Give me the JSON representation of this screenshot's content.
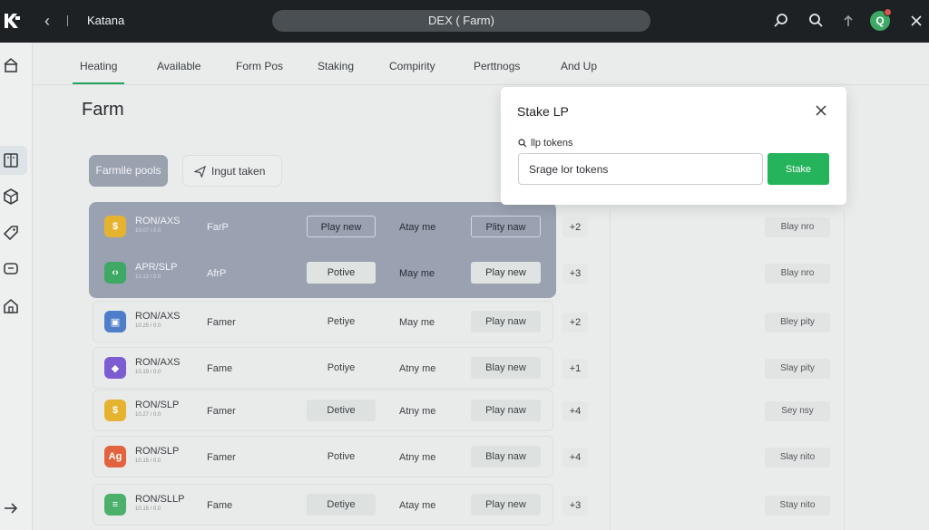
{
  "topbar": {
    "app_name": "Katana",
    "url_title": "DEX ( Farm)",
    "avatar_initial": "Q",
    "badge_color": "#d9534f"
  },
  "tabs": [
    {
      "label": "Heating",
      "active": true
    },
    {
      "label": "Available"
    },
    {
      "label": "Form Pos"
    },
    {
      "label": "Staking"
    },
    {
      "label": "Compirity"
    },
    {
      "label": "Perttnogs"
    },
    {
      "label": "And Up"
    }
  ],
  "page_title": "Farm",
  "filters": {
    "active_label": "Farmile pools",
    "input_label": "Ingut taken"
  },
  "rows": [
    {
      "pair": "RON/AXS",
      "sub": "10.07 / 0.0",
      "type": "FarP",
      "status": "Play new",
      "time": "Atay me",
      "action": "Plity naw",
      "count": "+2",
      "right": "Blay nro",
      "icon": "coin-icon",
      "icon_color": "#e6b331",
      "highlighted": true
    },
    {
      "pair": "APR/SLP",
      "sub": "10.12 / 0.0",
      "type": "AfrP",
      "status": "Potive",
      "time": "May me",
      "action": "Play new",
      "count": "+3",
      "right": "Blay nro",
      "icon": "code-icon",
      "icon_color": "#3ea865",
      "highlighted": true
    },
    {
      "pair": "RON/AXS",
      "sub": "10.25 / 0.0",
      "type": "Famer",
      "status": "Petiye",
      "time": "May me",
      "action": "Play naw",
      "count": "+2",
      "right": "Bley pity",
      "icon": "cube-icon",
      "icon_color": "#4e7ec9"
    },
    {
      "pair": "RON/AXS",
      "sub": "10.19 / 0.0",
      "type": "Fame",
      "status": "Potiye",
      "time": "Atny me",
      "action": "Blay new",
      "count": "+1",
      "right": "Slay pity",
      "icon": "shield-icon",
      "icon_color": "#7d5bd1"
    },
    {
      "pair": "RON/SLP",
      "sub": "10.27 / 0.0",
      "type": "Famer",
      "status": "Detive",
      "time": "Atny me",
      "action": "Play naw",
      "count": "+4",
      "right": "Sey nsy",
      "icon": "coin-icon",
      "icon_color": "#e6b331"
    },
    {
      "pair": "RON/SLP",
      "sub": "10.15 / 0.0",
      "type": "Famer",
      "status": "Potive",
      "time": "Atny me",
      "action": "Blay naw",
      "count": "+4",
      "right": "Slay nito",
      "icon": "ag-icon",
      "icon_color": "#e2643f"
    },
    {
      "pair": "RON/SLLP",
      "sub": "10.15 / 0.0",
      "type": "Fame",
      "status": "Detiye",
      "time": "Atay me",
      "action": "Play new",
      "count": "+3",
      "right": "Stay nito",
      "icon": "wifi-icon",
      "icon_color": "#4cb06b"
    }
  ],
  "modal": {
    "title": "Stake LP",
    "label": "llp tokens",
    "input_value": "Srage lor tokens",
    "button_label": "Stake",
    "accent": "#25b35b"
  }
}
